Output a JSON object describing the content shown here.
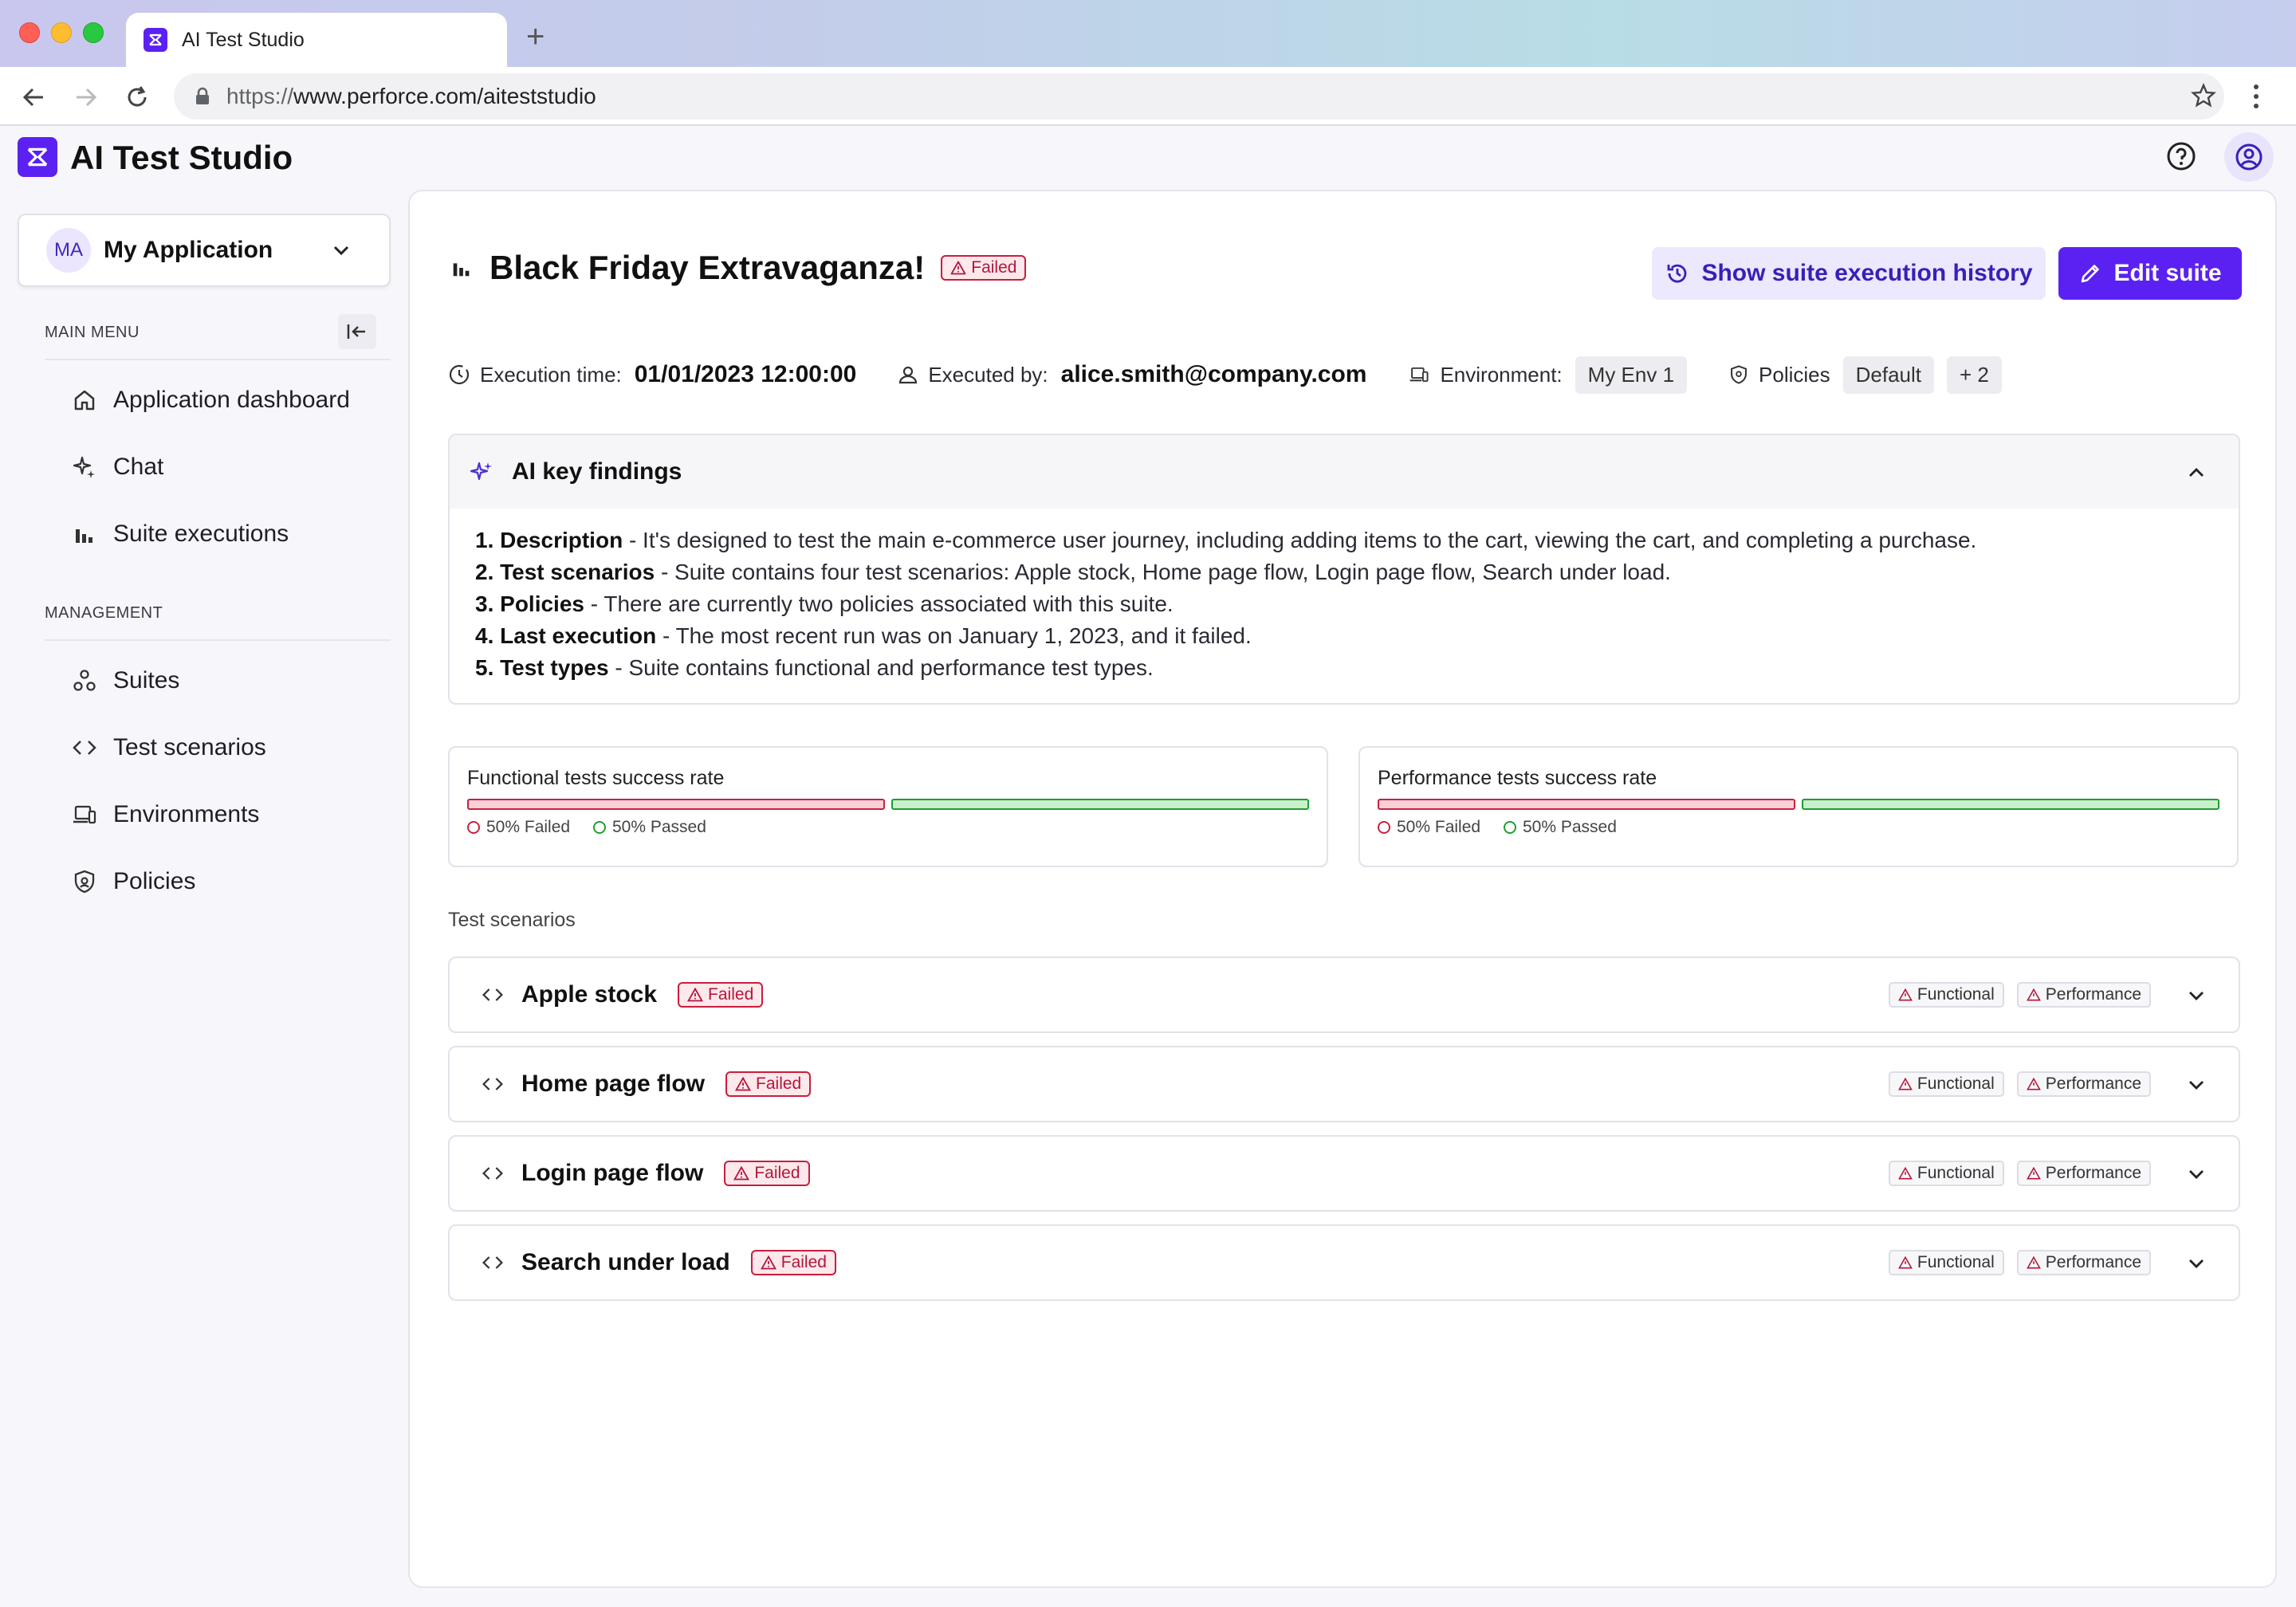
{
  "browser": {
    "tab_title": "AI Test Studio",
    "url_scheme": "https://",
    "url_rest": "www.perforce.com/aiteststudio"
  },
  "app": {
    "title": "AI Test Studio"
  },
  "sidebar": {
    "app_initials": "MA",
    "app_name": "My Application",
    "main_menu_label": "MAIN MENU",
    "management_label": "MANAGEMENT",
    "main_items": [
      {
        "label": "Application dashboard",
        "icon": "home-icon"
      },
      {
        "label": "Chat",
        "icon": "sparkle-icon"
      },
      {
        "label": "Suite executions",
        "icon": "bar-chart-icon"
      }
    ],
    "management_items": [
      {
        "label": "Suites",
        "icon": "suites-icon"
      },
      {
        "label": "Test scenarios",
        "icon": "code-icon"
      },
      {
        "label": "Environments",
        "icon": "devices-icon"
      },
      {
        "label": "Policies",
        "icon": "shield-icon"
      }
    ]
  },
  "suite": {
    "title": "Black Friday Extravaganza!",
    "status": "Failed",
    "history_button": "Show suite execution history",
    "edit_button": "Edit suite",
    "execution_time_label": "Execution time:",
    "execution_time": "01/01/2023 12:00:00",
    "executed_by_label": "Executed by:",
    "executed_by": "alice.smith@company.com",
    "environment_label": "Environment:",
    "environment": "My Env 1",
    "policies_label": "Policies",
    "policy": "Default",
    "policy_more": "+ 2"
  },
  "findings": {
    "title": "AI key findings",
    "items": [
      {
        "num": "1.",
        "label": "Description",
        "text": " - It's designed to test the main e-commerce user journey, including adding items to the cart, viewing the cart, and completing a purchase."
      },
      {
        "num": "2.",
        "label": "Test scenarios",
        "text": " - Suite contains four test scenarios: Apple stock, Home page flow, Login page flow, Search under load."
      },
      {
        "num": "3.",
        "label": "Policies",
        "text": " - There are currently two policies associated with this suite."
      },
      {
        "num": "4.",
        "label": "Last execution",
        "text": " - The most recent run was on January 1, 2023, and it failed."
      },
      {
        "num": "5.",
        "label": "Test types",
        "text": " - Suite contains functional and performance test types."
      }
    ]
  },
  "rates": [
    {
      "title": "Functional tests success rate",
      "failed_pct": 50,
      "passed_pct": 50,
      "failed_label": "50% Failed",
      "passed_label": "50% Passed"
    },
    {
      "title": "Performance tests success rate",
      "failed_pct": 50,
      "passed_pct": 50,
      "failed_label": "50% Failed",
      "passed_label": "50% Passed"
    }
  ],
  "scenarios": {
    "label": "Test scenarios",
    "status": "Failed",
    "tag_functional": "Functional",
    "tag_performance": "Performance",
    "items": [
      {
        "name": "Apple stock"
      },
      {
        "name": "Home page flow"
      },
      {
        "name": "Login page flow"
      },
      {
        "name": "Search under load"
      }
    ]
  },
  "colors": {
    "accent": "#5b21f2",
    "failed": "#c8213f",
    "passed": "#1f9d33"
  }
}
